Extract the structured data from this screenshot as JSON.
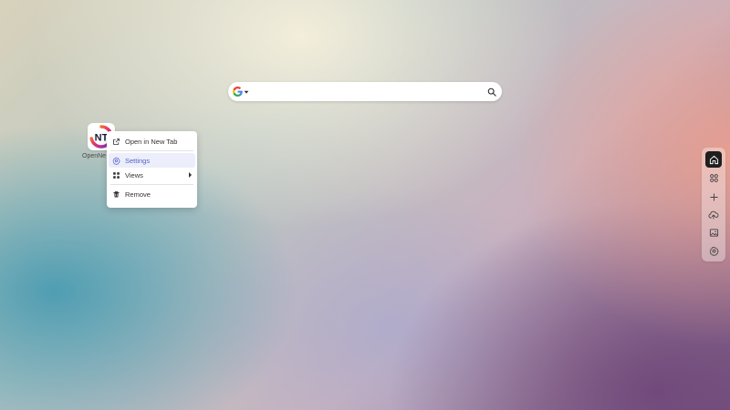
{
  "search": {
    "engine": "Google",
    "value": "",
    "placeholder": ""
  },
  "shortcut": {
    "label": "OpenNe",
    "logo_text": "NT"
  },
  "context_menu": {
    "items": [
      {
        "label": "Open in New Tab",
        "icon": "external-link-icon"
      },
      {
        "label": "Settings",
        "icon": "gear-icon",
        "active": true
      },
      {
        "label": "Views",
        "icon": "grid-icon",
        "has_submenu": true
      },
      {
        "label": "Remove",
        "icon": "trash-icon"
      }
    ]
  },
  "dock": {
    "items": [
      {
        "name": "home",
        "icon": "home-icon",
        "active": true
      },
      {
        "name": "widgets",
        "icon": "widgets-icon"
      },
      {
        "name": "add",
        "icon": "plus-icon"
      },
      {
        "name": "upload",
        "icon": "cloud-upload-icon"
      },
      {
        "name": "wallpaper",
        "icon": "image-icon"
      },
      {
        "name": "settings",
        "icon": "gear-icon"
      }
    ]
  },
  "colors": {
    "menu_active_bg": "#eceefb",
    "menu_active_text": "#5762c2",
    "dock_active_bg": "#1e1e1e"
  }
}
